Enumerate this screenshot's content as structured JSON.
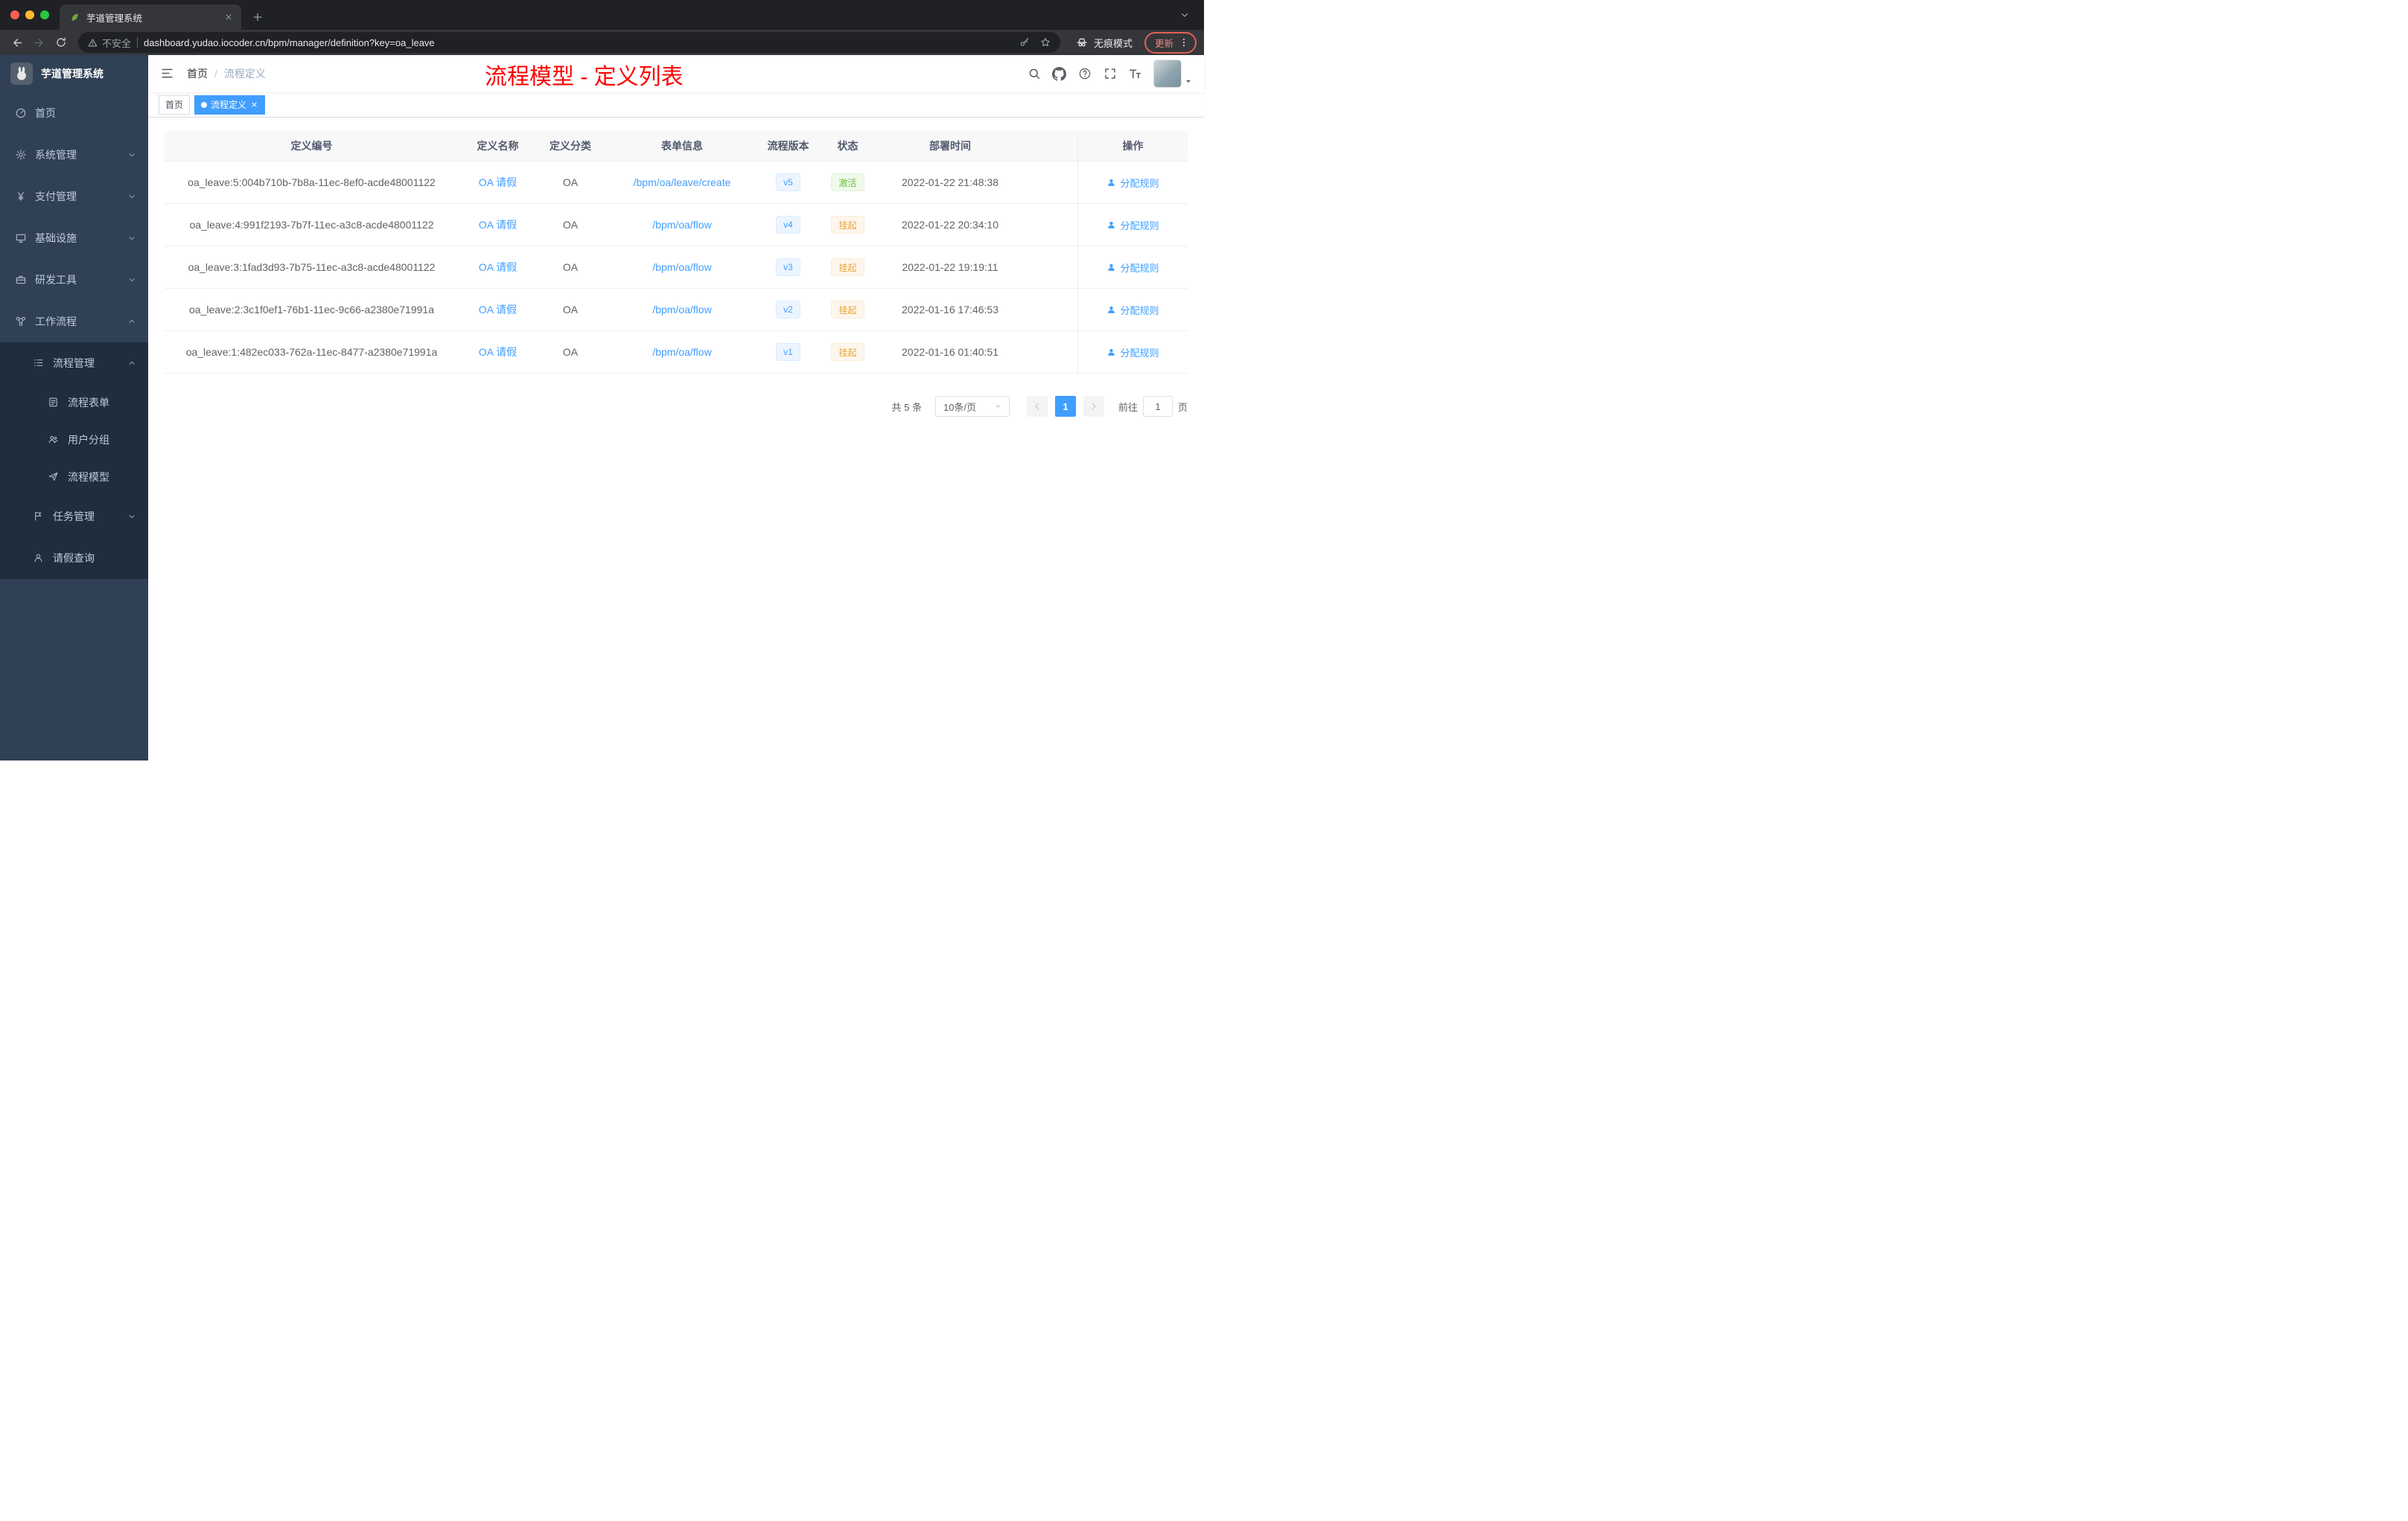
{
  "browser": {
    "tab_title": "芋道管理系统",
    "security_label": "不安全",
    "url": "dashboard.yudao.iocoder.cn/bpm/manager/definition?key=oa_leave",
    "incognito_label": "无痕模式",
    "update_label": "更新"
  },
  "sidebar": {
    "logo_title": "芋道管理系统",
    "items": [
      {
        "label": "首页"
      },
      {
        "label": "系统管理"
      },
      {
        "label": "支付管理"
      },
      {
        "label": "基础设施"
      },
      {
        "label": "研发工具"
      },
      {
        "label": "工作流程"
      },
      {
        "label": "流程管理"
      },
      {
        "label": "流程表单"
      },
      {
        "label": "用户分组"
      },
      {
        "label": "流程模型"
      },
      {
        "label": "任务管理"
      },
      {
        "label": "请假查询"
      }
    ]
  },
  "navbar": {
    "breadcrumb_root": "首页",
    "breadcrumb_separator": "/",
    "breadcrumb_current": "流程定义",
    "annotation_title": "流程模型 - 定义列表"
  },
  "tags": [
    {
      "label": "首页"
    },
    {
      "label": "流程定义"
    }
  ],
  "table": {
    "columns": [
      "定义编号",
      "定义名称",
      "定义分类",
      "表单信息",
      "流程版本",
      "状态",
      "部署时间",
      "操作"
    ],
    "rows": [
      {
        "id": "oa_leave:5:004b710b-7b8a-11ec-8ef0-acde48001122",
        "name": "OA 请假",
        "category": "OA",
        "form": "/bpm/oa/leave/create",
        "version": "v5",
        "status": "激活",
        "status_type": "success",
        "time": "2022-01-22 21:48:38",
        "action": "分配规则"
      },
      {
        "id": "oa_leave:4:991f2193-7b7f-11ec-a3c8-acde48001122",
        "name": "OA 请假",
        "category": "OA",
        "form": "/bpm/oa/flow",
        "version": "v4",
        "status": "挂起",
        "status_type": "warning",
        "time": "2022-01-22 20:34:10",
        "action": "分配规则"
      },
      {
        "id": "oa_leave:3:1fad3d93-7b75-11ec-a3c8-acde48001122",
        "name": "OA 请假",
        "category": "OA",
        "form": "/bpm/oa/flow",
        "version": "v3",
        "status": "挂起",
        "status_type": "warning",
        "time": "2022-01-22 19:19:11",
        "action": "分配规则"
      },
      {
        "id": "oa_leave:2:3c1f0ef1-76b1-11ec-9c66-a2380e71991a",
        "name": "OA 请假",
        "category": "OA",
        "form": "/bpm/oa/flow",
        "version": "v2",
        "status": "挂起",
        "status_type": "warning",
        "time": "2022-01-16 17:46:53",
        "action": "分配规则"
      },
      {
        "id": "oa_leave:1:482ec033-762a-11ec-8477-a2380e71991a",
        "name": "OA 请假",
        "category": "OA",
        "form": "/bpm/oa/flow",
        "version": "v1",
        "status": "挂起",
        "status_type": "warning",
        "time": "2022-01-16 01:40:51",
        "action": "分配规则"
      }
    ]
  },
  "pagination": {
    "total": "共 5 条",
    "page_size": "10条/页",
    "current_page": "1",
    "goto_label": "前往",
    "goto_value": "1",
    "page_unit": "页"
  },
  "colors": {
    "accent": "#409EFF",
    "success": "#67C23A",
    "warning": "#E6A23C",
    "sidebar_bg": "#304156",
    "sidebar_sub_bg": "#1F2D3D",
    "annotation": "#FF0000"
  }
}
